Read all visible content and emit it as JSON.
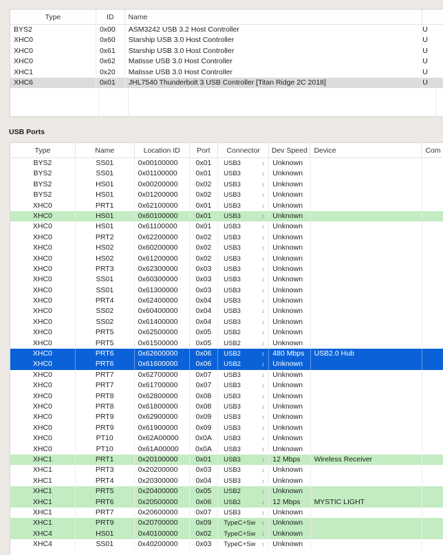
{
  "controllers": {
    "columns": [
      "Type",
      "ID",
      "Name",
      ""
    ],
    "rows": [
      {
        "type": "BYS2",
        "id": "0x00",
        "name": "ASM3242 USB 3.2 Host Controller",
        "extra": "U"
      },
      {
        "type": "XHC0",
        "id": "0x60",
        "name": "Starship USB 3.0 Host Controller",
        "extra": "U"
      },
      {
        "type": "XHC0",
        "id": "0x61",
        "name": "Starship USB 3.0 Host Controller",
        "extra": "U"
      },
      {
        "type": "XHC0",
        "id": "0x62",
        "name": "Matisse USB 3.0 Host Controller",
        "extra": "U"
      },
      {
        "type": "XHC1",
        "id": "0x20",
        "name": "Matisse USB 3.0 Host Controller",
        "extra": "U"
      },
      {
        "type": "XHC6",
        "id": "0x01",
        "name": "JHL7540 Thunderbolt 3 USB Controller [Titan Ridge 2C 2018]",
        "extra": "U",
        "state": "gray"
      }
    ]
  },
  "ports": {
    "section_label": "USB Ports",
    "columns": [
      "Type",
      "Name",
      "Location ID",
      "Port",
      "Connector",
      "Dev Speed",
      "Device",
      "Com"
    ],
    "colors": {
      "active": "#c3ecc2",
      "selected": "#0b62d8"
    },
    "rows": [
      {
        "type": "BYS2",
        "name": "SS01",
        "loc": "0x00100000",
        "port": "0x01",
        "conn": "USB3",
        "speed": "Unknown",
        "device": ""
      },
      {
        "type": "BYS2",
        "name": "SS01",
        "loc": "0x01100000",
        "port": "0x01",
        "conn": "USB3",
        "speed": "Unknown",
        "device": ""
      },
      {
        "type": "BYS2",
        "name": "HS01",
        "loc": "0x00200000",
        "port": "0x02",
        "conn": "USB3",
        "speed": "Unknown",
        "device": ""
      },
      {
        "type": "BYS2",
        "name": "HS01",
        "loc": "0x01200000",
        "port": "0x02",
        "conn": "USB3",
        "speed": "Unknown",
        "device": ""
      },
      {
        "type": "XHC0",
        "name": "PRT1",
        "loc": "0x62100000",
        "port": "0x01",
        "conn": "USB3",
        "speed": "Unknown",
        "device": ""
      },
      {
        "type": "XHC0",
        "name": "HS01",
        "loc": "0x60100000",
        "port": "0x01",
        "conn": "USB3",
        "speed": "Unknown",
        "device": "",
        "state": "green"
      },
      {
        "type": "XHC0",
        "name": "HS01",
        "loc": "0x61100000",
        "port": "0x01",
        "conn": "USB3",
        "speed": "Unknown",
        "device": ""
      },
      {
        "type": "XHC0",
        "name": "PRT2",
        "loc": "0x62200000",
        "port": "0x02",
        "conn": "USB3",
        "speed": "Unknown",
        "device": ""
      },
      {
        "type": "XHC0",
        "name": "HS02",
        "loc": "0x60200000",
        "port": "0x02",
        "conn": "USB3",
        "speed": "Unknown",
        "device": ""
      },
      {
        "type": "XHC0",
        "name": "HS02",
        "loc": "0x61200000",
        "port": "0x02",
        "conn": "USB3",
        "speed": "Unknown",
        "device": ""
      },
      {
        "type": "XHC0",
        "name": "PRT3",
        "loc": "0x62300000",
        "port": "0x03",
        "conn": "USB3",
        "speed": "Unknown",
        "device": ""
      },
      {
        "type": "XHC0",
        "name": "SS01",
        "loc": "0x60300000",
        "port": "0x03",
        "conn": "USB3",
        "speed": "Unknown",
        "device": ""
      },
      {
        "type": "XHC0",
        "name": "SS01",
        "loc": "0x61300000",
        "port": "0x03",
        "conn": "USB3",
        "speed": "Unknown",
        "device": ""
      },
      {
        "type": "XHC0",
        "name": "PRT4",
        "loc": "0x62400000",
        "port": "0x04",
        "conn": "USB3",
        "speed": "Unknown",
        "device": ""
      },
      {
        "type": "XHC0",
        "name": "SS02",
        "loc": "0x60400000",
        "port": "0x04",
        "conn": "USB3",
        "speed": "Unknown",
        "device": ""
      },
      {
        "type": "XHC0",
        "name": "SS02",
        "loc": "0x61400000",
        "port": "0x04",
        "conn": "USB3",
        "speed": "Unknown",
        "device": ""
      },
      {
        "type": "XHC0",
        "name": "PRT5",
        "loc": "0x62500000",
        "port": "0x05",
        "conn": "USB2",
        "speed": "Unknown",
        "device": ""
      },
      {
        "type": "XHC0",
        "name": "PRT5",
        "loc": "0x61500000",
        "port": "0x05",
        "conn": "USB2",
        "speed": "Unknown",
        "device": ""
      },
      {
        "type": "XHC0",
        "name": "PRT6",
        "loc": "0x62600000",
        "port": "0x06",
        "conn": "USB2",
        "speed": "480 Mbps",
        "device": "USB2.0 Hub",
        "state": "sel"
      },
      {
        "type": "XHC0",
        "name": "PRT6",
        "loc": "0x61600000",
        "port": "0x06",
        "conn": "USB2",
        "speed": "Unknown",
        "device": "",
        "state": "sel"
      },
      {
        "type": "XHC0",
        "name": "PRT7",
        "loc": "0x62700000",
        "port": "0x07",
        "conn": "USB3",
        "speed": "Unknown",
        "device": ""
      },
      {
        "type": "XHC0",
        "name": "PRT7",
        "loc": "0x61700000",
        "port": "0x07",
        "conn": "USB3",
        "speed": "Unknown",
        "device": ""
      },
      {
        "type": "XHC0",
        "name": "PRT8",
        "loc": "0x62800000",
        "port": "0x08",
        "conn": "USB3",
        "speed": "Unknown",
        "device": ""
      },
      {
        "type": "XHC0",
        "name": "PRT8",
        "loc": "0x61800000",
        "port": "0x08",
        "conn": "USB3",
        "speed": "Unknown",
        "device": ""
      },
      {
        "type": "XHC0",
        "name": "PRT9",
        "loc": "0x62900000",
        "port": "0x09",
        "conn": "USB3",
        "speed": "Unknown",
        "device": ""
      },
      {
        "type": "XHC0",
        "name": "PRT9",
        "loc": "0x61900000",
        "port": "0x09",
        "conn": "USB3",
        "speed": "Unknown",
        "device": ""
      },
      {
        "type": "XHC0",
        "name": "PT10",
        "loc": "0x62A00000",
        "port": "0x0A",
        "conn": "USB3",
        "speed": "Unknown",
        "device": ""
      },
      {
        "type": "XHC0",
        "name": "PT10",
        "loc": "0x61A00000",
        "port": "0x0A",
        "conn": "USB3",
        "speed": "Unknown",
        "device": ""
      },
      {
        "type": "XHC1",
        "name": "PRT1",
        "loc": "0x20100000",
        "port": "0x01",
        "conn": "USB3",
        "speed": "12 Mbps",
        "device": "Wireless Receiver",
        "state": "green"
      },
      {
        "type": "XHC1",
        "name": "PRT3",
        "loc": "0x20200000",
        "port": "0x03",
        "conn": "USB3",
        "speed": "Unknown",
        "device": ""
      },
      {
        "type": "XHC1",
        "name": "PRT4",
        "loc": "0x20300000",
        "port": "0x04",
        "conn": "USB3",
        "speed": "Unknown",
        "device": ""
      },
      {
        "type": "XHC1",
        "name": "PRT5",
        "loc": "0x20400000",
        "port": "0x05",
        "conn": "USB2",
        "speed": "Unknown",
        "device": "",
        "state": "green"
      },
      {
        "type": "XHC1",
        "name": "PRT6",
        "loc": "0x20500000",
        "port": "0x06",
        "conn": "USB2",
        "speed": "12 Mbps",
        "device": "MYSTIC LIGHT",
        "state": "green"
      },
      {
        "type": "XHC1",
        "name": "PRT7",
        "loc": "0x20600000",
        "port": "0x07",
        "conn": "USB3",
        "speed": "Unknown",
        "device": ""
      },
      {
        "type": "XHC1",
        "name": "PRT9",
        "loc": "0x20700000",
        "port": "0x09",
        "conn": "TypeC+Sw",
        "speed": "Unknown",
        "device": "",
        "state": "green"
      },
      {
        "type": "XHC4",
        "name": "HS01",
        "loc": "0x40100000",
        "port": "0x02",
        "conn": "TypeC+Sw",
        "speed": "Unknown",
        "device": "",
        "state": "green"
      },
      {
        "type": "XHC4",
        "name": "SS01",
        "loc": "0x40200000",
        "port": "0x03",
        "conn": "TypeC+Sw",
        "speed": "Unknown",
        "device": ""
      }
    ]
  }
}
